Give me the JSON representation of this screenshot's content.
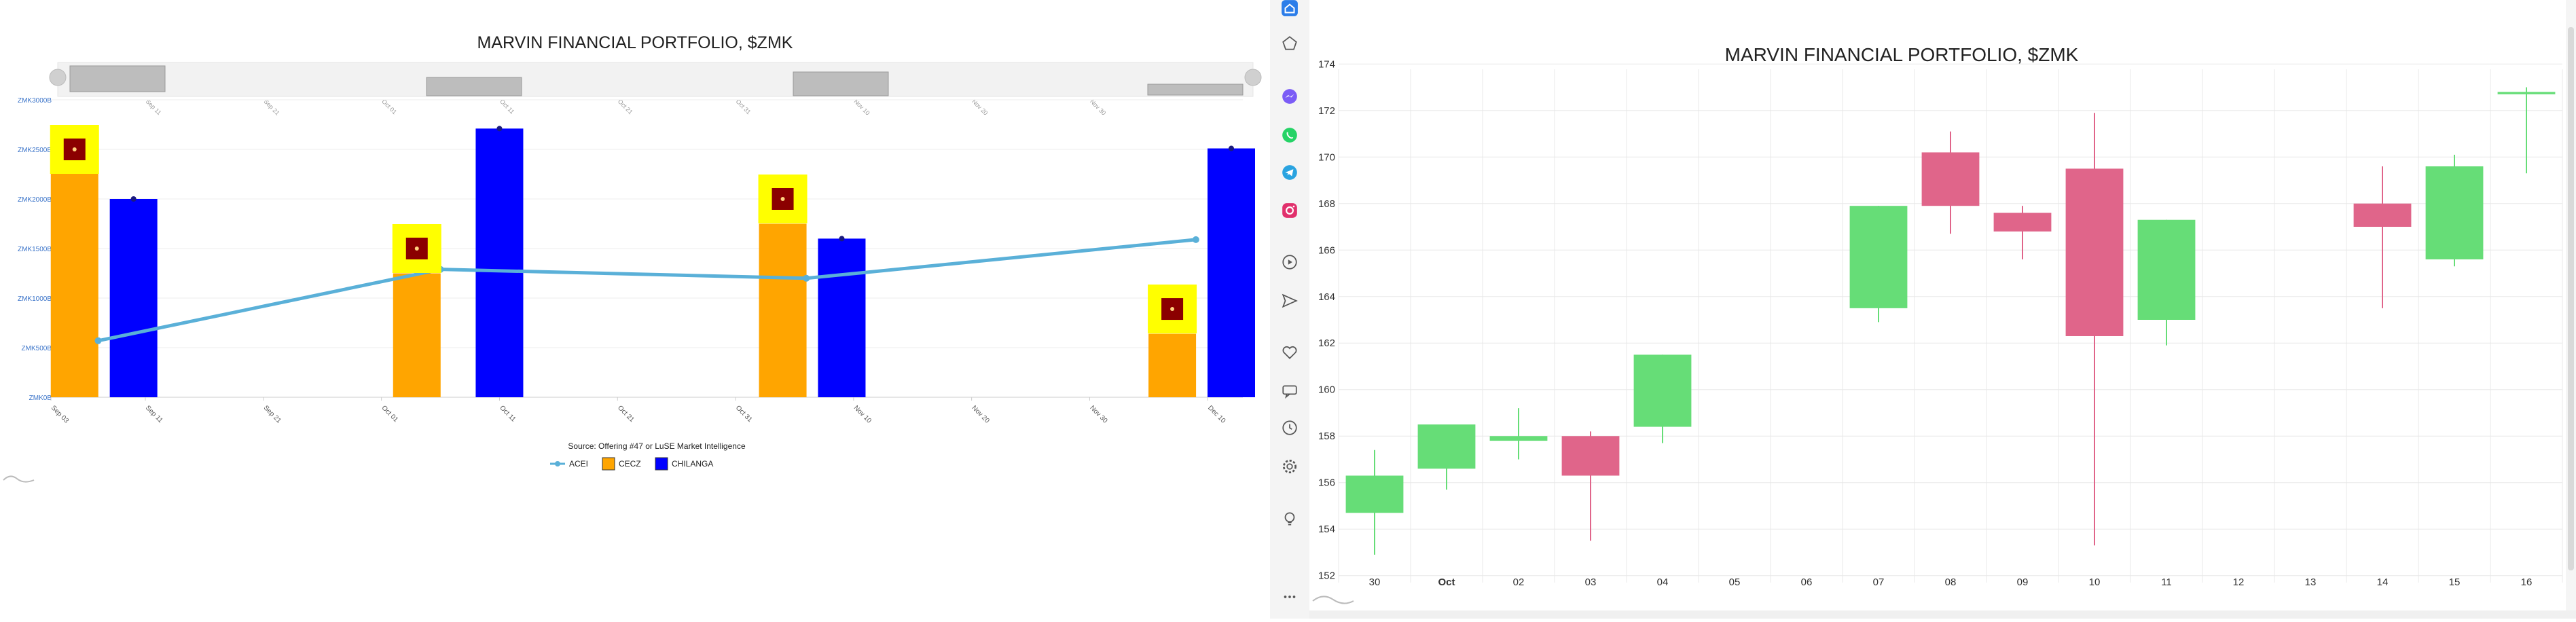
{
  "left_chart": {
    "title": "MARVIN FINANCIAL PORTFOLIO, $ZMK",
    "source": "Source: Offering #47 or LuSE Market Intelligence",
    "navigator_labels": [
      "Sep 11",
      "Sep 21",
      "Oct 01",
      "Oct 11",
      "Oct 21",
      "Oct 31",
      "Nov 10",
      "Nov 20",
      "Nov 30"
    ],
    "legend": [
      {
        "name": "ACEI",
        "color": "#5ab0d8",
        "kind": "line"
      },
      {
        "name": "CECZ",
        "color": "#ffa500",
        "kind": "box"
      },
      {
        "name": "CHILANGA",
        "color": "#0000ff",
        "kind": "box"
      }
    ]
  },
  "right_chart": {
    "title": "MARVIN FINANCIAL PORTFOLIO, $ZMK"
  },
  "sidebar": {
    "items": [
      {
        "name": "home-icon",
        "active": true
      },
      {
        "name": "pentagon-icon"
      },
      {
        "name": "messenger-icon"
      },
      {
        "name": "whatsapp-icon"
      },
      {
        "name": "telegram-icon"
      },
      {
        "name": "instagram-icon"
      },
      {
        "name": "play-circle-icon"
      },
      {
        "name": "send-icon"
      },
      {
        "name": "heart-icon"
      },
      {
        "name": "chat-icon"
      },
      {
        "name": "clock-icon"
      },
      {
        "name": "gear-icon"
      },
      {
        "name": "lightbulb-icon"
      },
      {
        "name": "more-icon"
      }
    ]
  },
  "chart_data": [
    {
      "type": "bar",
      "title": "MARVIN FINANCIAL PORTFOLIO, $ZMK",
      "subtitle": "Source: Offering #47 or LuSE Market Intelligence",
      "x_tick_labels": [
        "Sep 03",
        "Sep 11",
        "Sep 21",
        "Oct 01",
        "Oct 11",
        "Oct 21",
        "Oct 31",
        "Nov 10",
        "Nov 20",
        "Nov 30",
        "Dec 10"
      ],
      "y_tick_labels": [
        "ZMK0B",
        "ZMK500B",
        "ZMK1000B",
        "ZMK1500B",
        "ZMK2000B",
        "ZMK2500B",
        "ZMK3000B"
      ],
      "ylim": [
        0,
        3000
      ],
      "y_unit": "ZMK billions",
      "grid": true,
      "legend_position": "bottom",
      "series": [
        {
          "name": "ACEI",
          "kind": "line",
          "color": "#5ab0d8",
          "points": [
            [
              "Sep 07",
              570
            ],
            [
              "Oct 06",
              1290
            ],
            [
              "Nov 06",
              1200
            ],
            [
              "Dec 09",
              1590
            ]
          ]
        },
        {
          "name": "CECZ",
          "kind": "bar",
          "color": "#ffa500",
          "points": [
            [
              "Sep 05",
              2270
            ],
            [
              "Oct 04",
              1250
            ],
            [
              "Nov 04",
              1750
            ],
            [
              "Dec 07",
              640
            ]
          ]
        },
        {
          "name": "CHILANGA",
          "kind": "bar",
          "color": "#0000ff",
          "points": [
            [
              "Sep 10",
              2000
            ],
            [
              "Oct 11",
              2710
            ],
            [
              "Nov 09",
              1600
            ],
            [
              "Dec 12",
              2510
            ]
          ]
        }
      ],
      "annotations": [
        {
          "date": "Sep 05",
          "value": 2500
        },
        {
          "date": "Oct 04",
          "value": 1500
        },
        {
          "date": "Nov 04",
          "value": 2000
        },
        {
          "date": "Dec 07",
          "value": 890
        }
      ]
    },
    {
      "type": "candlestick",
      "title": "MARVIN FINANCIAL PORTFOLIO, $ZMK",
      "categories": [
        "30",
        "Oct",
        "02",
        "03",
        "04",
        "05",
        "06",
        "07",
        "08",
        "09",
        "10",
        "11",
        "12",
        "13",
        "14",
        "15",
        "16"
      ],
      "y_ticks": [
        152,
        154,
        156,
        158,
        160,
        162,
        164,
        166,
        168,
        170,
        172,
        174
      ],
      "ylim": [
        151.7,
        174.3
      ],
      "grid": true,
      "up_color": "#66dd77",
      "down_color": "#e0658a",
      "candles": [
        {
          "x": "30",
          "open": 154.7,
          "high": 157.4,
          "low": 152.9,
          "close": 156.3
        },
        {
          "x": "Oct",
          "open": 156.6,
          "high": 158.4,
          "low": 155.7,
          "close": 158.5
        },
        {
          "x": "02",
          "open": 157.8,
          "high": 159.2,
          "low": 157.0,
          "close": 158.0
        },
        {
          "x": "03",
          "open": 158.0,
          "high": 158.2,
          "low": 153.5,
          "close": 156.3
        },
        {
          "x": "04",
          "open": 158.4,
          "high": 161.5,
          "low": 157.7,
          "close": 161.5
        },
        {
          "x": "07",
          "open": 163.5,
          "high": 167.9,
          "low": 162.9,
          "close": 167.9
        },
        {
          "x": "08",
          "open": 170.2,
          "high": 171.1,
          "low": 166.7,
          "close": 167.9
        },
        {
          "x": "09",
          "open": 167.6,
          "high": 167.9,
          "low": 165.6,
          "close": 166.8
        },
        {
          "x": "10",
          "open": 169.5,
          "high": 171.9,
          "low": 153.3,
          "close": 162.3
        },
        {
          "x": "11",
          "open": 163.0,
          "high": 167.3,
          "low": 161.9,
          "close": 167.3
        },
        {
          "x": "14",
          "open": 168.0,
          "high": 169.6,
          "low": 163.5,
          "close": 167.0
        },
        {
          "x": "15",
          "open": 165.6,
          "high": 170.1,
          "low": 165.3,
          "close": 169.6
        },
        {
          "x": "16",
          "open": 172.7,
          "high": 173.0,
          "low": 169.3,
          "close": 172.8
        }
      ]
    }
  ]
}
